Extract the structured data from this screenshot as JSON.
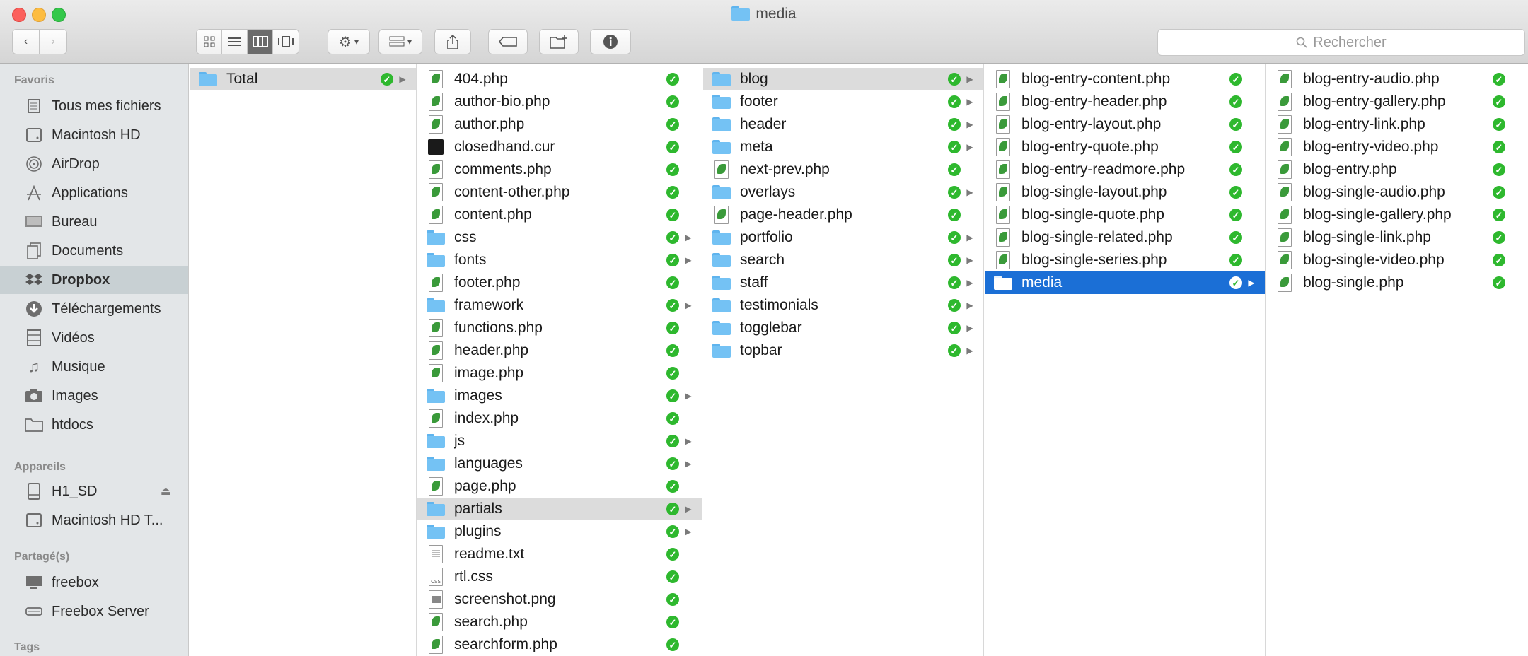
{
  "window": {
    "title": "media"
  },
  "toolbar": {
    "back_icon": "chevron-left-icon",
    "forward_icon": "chevron-right-icon",
    "view_modes": [
      "icon-view",
      "list-view",
      "column-view",
      "cover-flow-view"
    ],
    "active_view": "column-view",
    "search_placeholder": "Rechercher"
  },
  "sidebar": {
    "favoris_header": "Favoris",
    "favoris": [
      {
        "label": "Tous mes fichiers",
        "icon": "all-files-icon"
      },
      {
        "label": "Macintosh HD",
        "icon": "hard-drive-icon"
      },
      {
        "label": "AirDrop",
        "icon": "airdrop-icon"
      },
      {
        "label": "Applications",
        "icon": "applications-icon"
      },
      {
        "label": "Bureau",
        "icon": "desktop-icon"
      },
      {
        "label": "Documents",
        "icon": "documents-icon"
      },
      {
        "label": "Dropbox",
        "icon": "dropbox-icon"
      },
      {
        "label": "Téléchargements",
        "icon": "downloads-icon"
      },
      {
        "label": "Vidéos",
        "icon": "movies-icon"
      },
      {
        "label": "Musique",
        "icon": "music-icon"
      },
      {
        "label": "Images",
        "icon": "pictures-icon"
      },
      {
        "label": "htdocs",
        "icon": "folder-icon"
      }
    ],
    "appareils_header": "Appareils",
    "appareils": [
      {
        "label": "H1_SD",
        "icon": "disk-icon"
      },
      {
        "label": "Macintosh HD T...",
        "icon": "hard-drive-icon"
      }
    ],
    "partages_header": "Partagé(s)",
    "partages": [
      {
        "label": "freebox",
        "icon": "server-icon"
      },
      {
        "label": "Freebox Server",
        "icon": "server-icon"
      }
    ],
    "tags_header": "Tags"
  },
  "columns": [
    {
      "items": [
        {
          "name": "Total",
          "type": "folder",
          "chevron": true,
          "state": "gray"
        }
      ]
    },
    {
      "items": [
        {
          "name": "404.php",
          "type": "php"
        },
        {
          "name": "author-bio.php",
          "type": "php"
        },
        {
          "name": "author.php",
          "type": "php"
        },
        {
          "name": "closedhand.cur",
          "type": "cur"
        },
        {
          "name": "comments.php",
          "type": "php"
        },
        {
          "name": "content-other.php",
          "type": "php"
        },
        {
          "name": "content.php",
          "type": "php"
        },
        {
          "name": "css",
          "type": "folder",
          "chevron": true
        },
        {
          "name": "fonts",
          "type": "folder",
          "chevron": true
        },
        {
          "name": "footer.php",
          "type": "php"
        },
        {
          "name": "framework",
          "type": "folder",
          "chevron": true
        },
        {
          "name": "functions.php",
          "type": "php"
        },
        {
          "name": "header.php",
          "type": "php"
        },
        {
          "name": "image.php",
          "type": "php"
        },
        {
          "name": "images",
          "type": "folder",
          "chevron": true
        },
        {
          "name": "index.php",
          "type": "php"
        },
        {
          "name": "js",
          "type": "folder",
          "chevron": true
        },
        {
          "name": "languages",
          "type": "folder",
          "chevron": true
        },
        {
          "name": "page.php",
          "type": "php"
        },
        {
          "name": "partials",
          "type": "folder",
          "chevron": true,
          "state": "gray"
        },
        {
          "name": "plugins",
          "type": "folder",
          "chevron": true
        },
        {
          "name": "readme.txt",
          "type": "txt"
        },
        {
          "name": "rtl.css",
          "type": "css"
        },
        {
          "name": "screenshot.png",
          "type": "png"
        },
        {
          "name": "search.php",
          "type": "php"
        },
        {
          "name": "searchform.php",
          "type": "php"
        }
      ]
    },
    {
      "items": [
        {
          "name": "blog",
          "type": "folder",
          "chevron": true,
          "state": "gray"
        },
        {
          "name": "footer",
          "type": "folder",
          "chevron": true
        },
        {
          "name": "header",
          "type": "folder",
          "chevron": true
        },
        {
          "name": "meta",
          "type": "folder",
          "chevron": true
        },
        {
          "name": "next-prev.php",
          "type": "php"
        },
        {
          "name": "overlays",
          "type": "folder",
          "chevron": true
        },
        {
          "name": "page-header.php",
          "type": "php"
        },
        {
          "name": "portfolio",
          "type": "folder",
          "chevron": true
        },
        {
          "name": "search",
          "type": "folder",
          "chevron": true
        },
        {
          "name": "staff",
          "type": "folder",
          "chevron": true
        },
        {
          "name": "testimonials",
          "type": "folder",
          "chevron": true
        },
        {
          "name": "togglebar",
          "type": "folder",
          "chevron": true
        },
        {
          "name": "topbar",
          "type": "folder",
          "chevron": true
        }
      ]
    },
    {
      "items": [
        {
          "name": "blog-entry-content.php",
          "type": "php"
        },
        {
          "name": "blog-entry-header.php",
          "type": "php"
        },
        {
          "name": "blog-entry-layout.php",
          "type": "php"
        },
        {
          "name": "blog-entry-quote.php",
          "type": "php"
        },
        {
          "name": "blog-entry-readmore.php",
          "type": "php"
        },
        {
          "name": "blog-single-layout.php",
          "type": "php"
        },
        {
          "name": "blog-single-quote.php",
          "type": "php"
        },
        {
          "name": "blog-single-related.php",
          "type": "php"
        },
        {
          "name": "blog-single-series.php",
          "type": "php"
        },
        {
          "name": "media",
          "type": "folder",
          "chevron": true,
          "state": "blue"
        }
      ]
    },
    {
      "items": [
        {
          "name": "blog-entry-audio.php",
          "type": "php"
        },
        {
          "name": "blog-entry-gallery.php",
          "type": "php"
        },
        {
          "name": "blog-entry-link.php",
          "type": "php"
        },
        {
          "name": "blog-entry-video.php",
          "type": "php"
        },
        {
          "name": "blog-entry.php",
          "type": "php"
        },
        {
          "name": "blog-single-audio.php",
          "type": "php"
        },
        {
          "name": "blog-single-gallery.php",
          "type": "php"
        },
        {
          "name": "blog-single-link.php",
          "type": "php"
        },
        {
          "name": "blog-single-video.php",
          "type": "php"
        },
        {
          "name": "blog-single.php",
          "type": "php"
        }
      ]
    }
  ],
  "colors": {
    "selection_blue": "#1b6fd6",
    "selection_gray": "#dcdcdc",
    "sync_green": "#2eb82e",
    "folder_blue": "#74c2f4"
  }
}
